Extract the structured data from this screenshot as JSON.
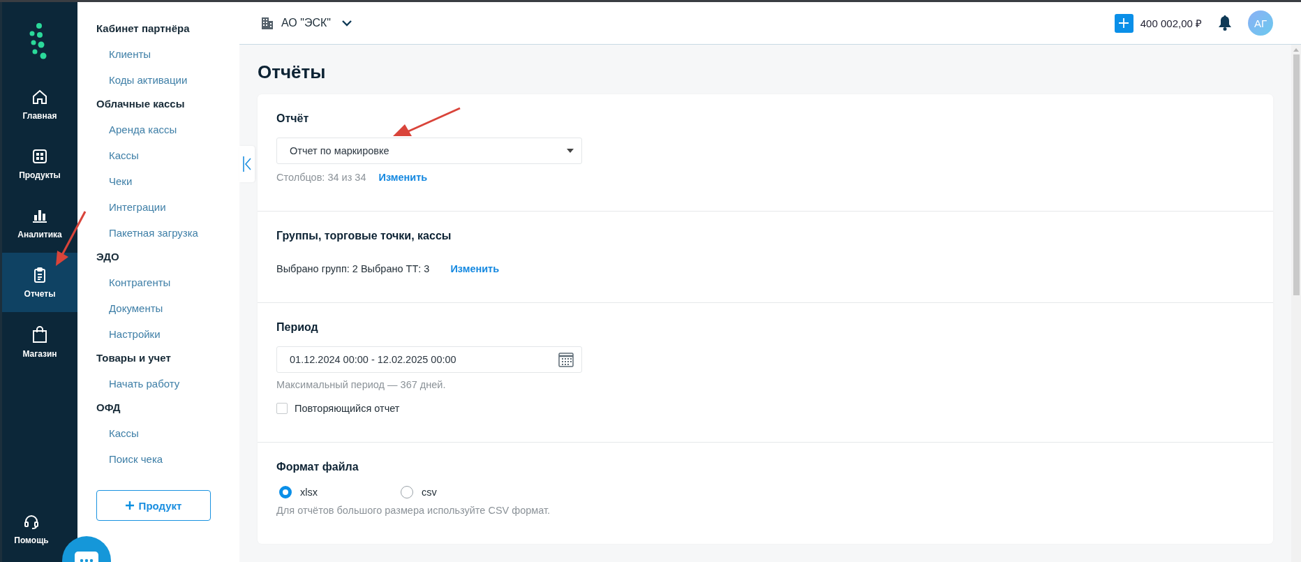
{
  "rail": {
    "items": [
      {
        "label": "Главная",
        "selected": false
      },
      {
        "label": "Продукты",
        "selected": false
      },
      {
        "label": "Аналитика",
        "selected": false
      },
      {
        "label": "Отчеты",
        "selected": true
      },
      {
        "label": "Магазин",
        "selected": false
      }
    ],
    "help": "Помощь"
  },
  "sidebar": {
    "groups": [
      {
        "title": "Кабинет партнёра",
        "items": [
          {
            "label": "Клиенты",
            "selected": false
          },
          {
            "label": "Коды активации",
            "selected": false
          }
        ]
      },
      {
        "title": "Облачные кассы",
        "items": [
          {
            "label": "Аренда кассы",
            "selected": false
          },
          {
            "label": "Кассы",
            "selected": false
          },
          {
            "label": "Чеки",
            "selected": false
          },
          {
            "label": "Интеграции",
            "selected": false
          },
          {
            "label": "Пакетная загрузка",
            "selected": false
          }
        ]
      },
      {
        "title": "ЭДО",
        "items": [
          {
            "label": "Контрагенты",
            "selected": false
          },
          {
            "label": "Документы",
            "selected": false
          },
          {
            "label": "Настройки",
            "selected": false
          }
        ]
      },
      {
        "title": "Товары и учет",
        "items": [
          {
            "label": "Начать работу",
            "selected": false
          }
        ]
      },
      {
        "title": "ОФД",
        "items": [
          {
            "label": "Кассы",
            "selected": false
          },
          {
            "label": "Поиск чека",
            "selected": false
          }
        ]
      }
    ],
    "button": "Продукт"
  },
  "header": {
    "company": "АО \"ЭСК\"",
    "balance": "400 002,00 ₽",
    "avatar": "АГ"
  },
  "page_title": "Отчёты",
  "report": {
    "title": "Отчёт",
    "select_value": "Отчет по маркировке",
    "columns": "Столбцов: 34 из 34",
    "link": "Изменить"
  },
  "groups": {
    "title": "Группы, торговые точки, кассы",
    "summary": "Выбрано групп: 2 Выбрано ТТ: 3",
    "link": "Изменить"
  },
  "period": {
    "title": "Период",
    "value": "01.12.2024 00:00 - 12.02.2025 00:00",
    "hint": "Максимальный период — 367 дней.",
    "repeat": {
      "label": "Повторяющийся отчет",
      "checked": false
    }
  },
  "format": {
    "title": "Формат файла",
    "options": [
      {
        "label": "xlsx",
        "selected": true
      },
      {
        "label": "csv",
        "selected": false
      }
    ],
    "hint": "Для отчётов большого размера используйте CSV формат."
  }
}
